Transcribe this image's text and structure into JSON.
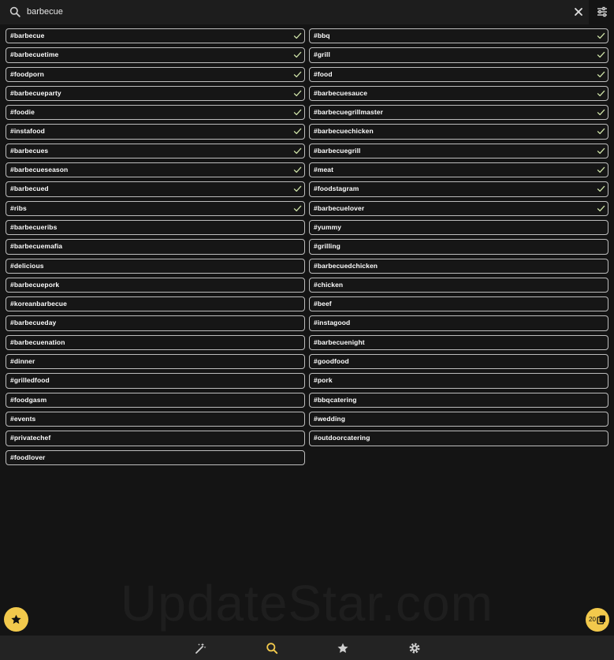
{
  "search": {
    "query": "barbecue"
  },
  "tags_left": [
    {
      "label": "#barbecue",
      "selected": true
    },
    {
      "label": "#barbecuetime",
      "selected": true
    },
    {
      "label": "#foodporn",
      "selected": true
    },
    {
      "label": "#barbecueparty",
      "selected": true
    },
    {
      "label": "#foodie",
      "selected": true
    },
    {
      "label": "#instafood",
      "selected": true
    },
    {
      "label": "#barbecues",
      "selected": true
    },
    {
      "label": "#barbecueseason",
      "selected": true
    },
    {
      "label": "#barbecued",
      "selected": true
    },
    {
      "label": "#ribs",
      "selected": true
    },
    {
      "label": "#barbecueribs",
      "selected": false
    },
    {
      "label": "#barbecuemafia",
      "selected": false
    },
    {
      "label": "#delicious",
      "selected": false
    },
    {
      "label": "#barbecuepork",
      "selected": false
    },
    {
      "label": "#koreanbarbecue",
      "selected": false
    },
    {
      "label": "#barbecueday",
      "selected": false
    },
    {
      "label": "#barbecuenation",
      "selected": false
    },
    {
      "label": "#dinner",
      "selected": false
    },
    {
      "label": "#grilledfood",
      "selected": false
    },
    {
      "label": "#foodgasm",
      "selected": false
    },
    {
      "label": "#events",
      "selected": false
    },
    {
      "label": "#privatechef",
      "selected": false
    },
    {
      "label": "#foodlover",
      "selected": false
    }
  ],
  "tags_right": [
    {
      "label": "#bbq",
      "selected": true
    },
    {
      "label": "#grill",
      "selected": true
    },
    {
      "label": "#food",
      "selected": true
    },
    {
      "label": "#barbecuesauce",
      "selected": true
    },
    {
      "label": "#barbecuegrillmaster",
      "selected": true
    },
    {
      "label": "#barbecuechicken",
      "selected": true
    },
    {
      "label": "#barbecuegrill",
      "selected": true
    },
    {
      "label": "#meat",
      "selected": true
    },
    {
      "label": "#foodstagram",
      "selected": true
    },
    {
      "label": "#barbecuelover",
      "selected": true
    },
    {
      "label": "#yummy",
      "selected": false
    },
    {
      "label": "#grilling",
      "selected": false
    },
    {
      "label": "#barbecuedchicken",
      "selected": false
    },
    {
      "label": "#chicken",
      "selected": false
    },
    {
      "label": "#beef",
      "selected": false
    },
    {
      "label": "#instagood",
      "selected": false
    },
    {
      "label": "#barbecuenight",
      "selected": false
    },
    {
      "label": "#goodfood",
      "selected": false
    },
    {
      "label": "#pork",
      "selected": false
    },
    {
      "label": "#bbqcatering",
      "selected": false
    },
    {
      "label": "#wedding",
      "selected": false
    },
    {
      "label": "#outdoorcatering",
      "selected": false
    }
  ],
  "watermark": "UpdateStar.com",
  "selected_count": "20",
  "colors": {
    "accent": "#f2c94c",
    "check": "#cfe3a8",
    "background": "#141414",
    "nav": "#232323"
  },
  "bottom_nav": [
    {
      "icon": "magic-wand-icon",
      "active": false
    },
    {
      "icon": "search-icon",
      "active": true
    },
    {
      "icon": "star-icon",
      "active": false
    },
    {
      "icon": "gear-icon",
      "active": false
    }
  ]
}
